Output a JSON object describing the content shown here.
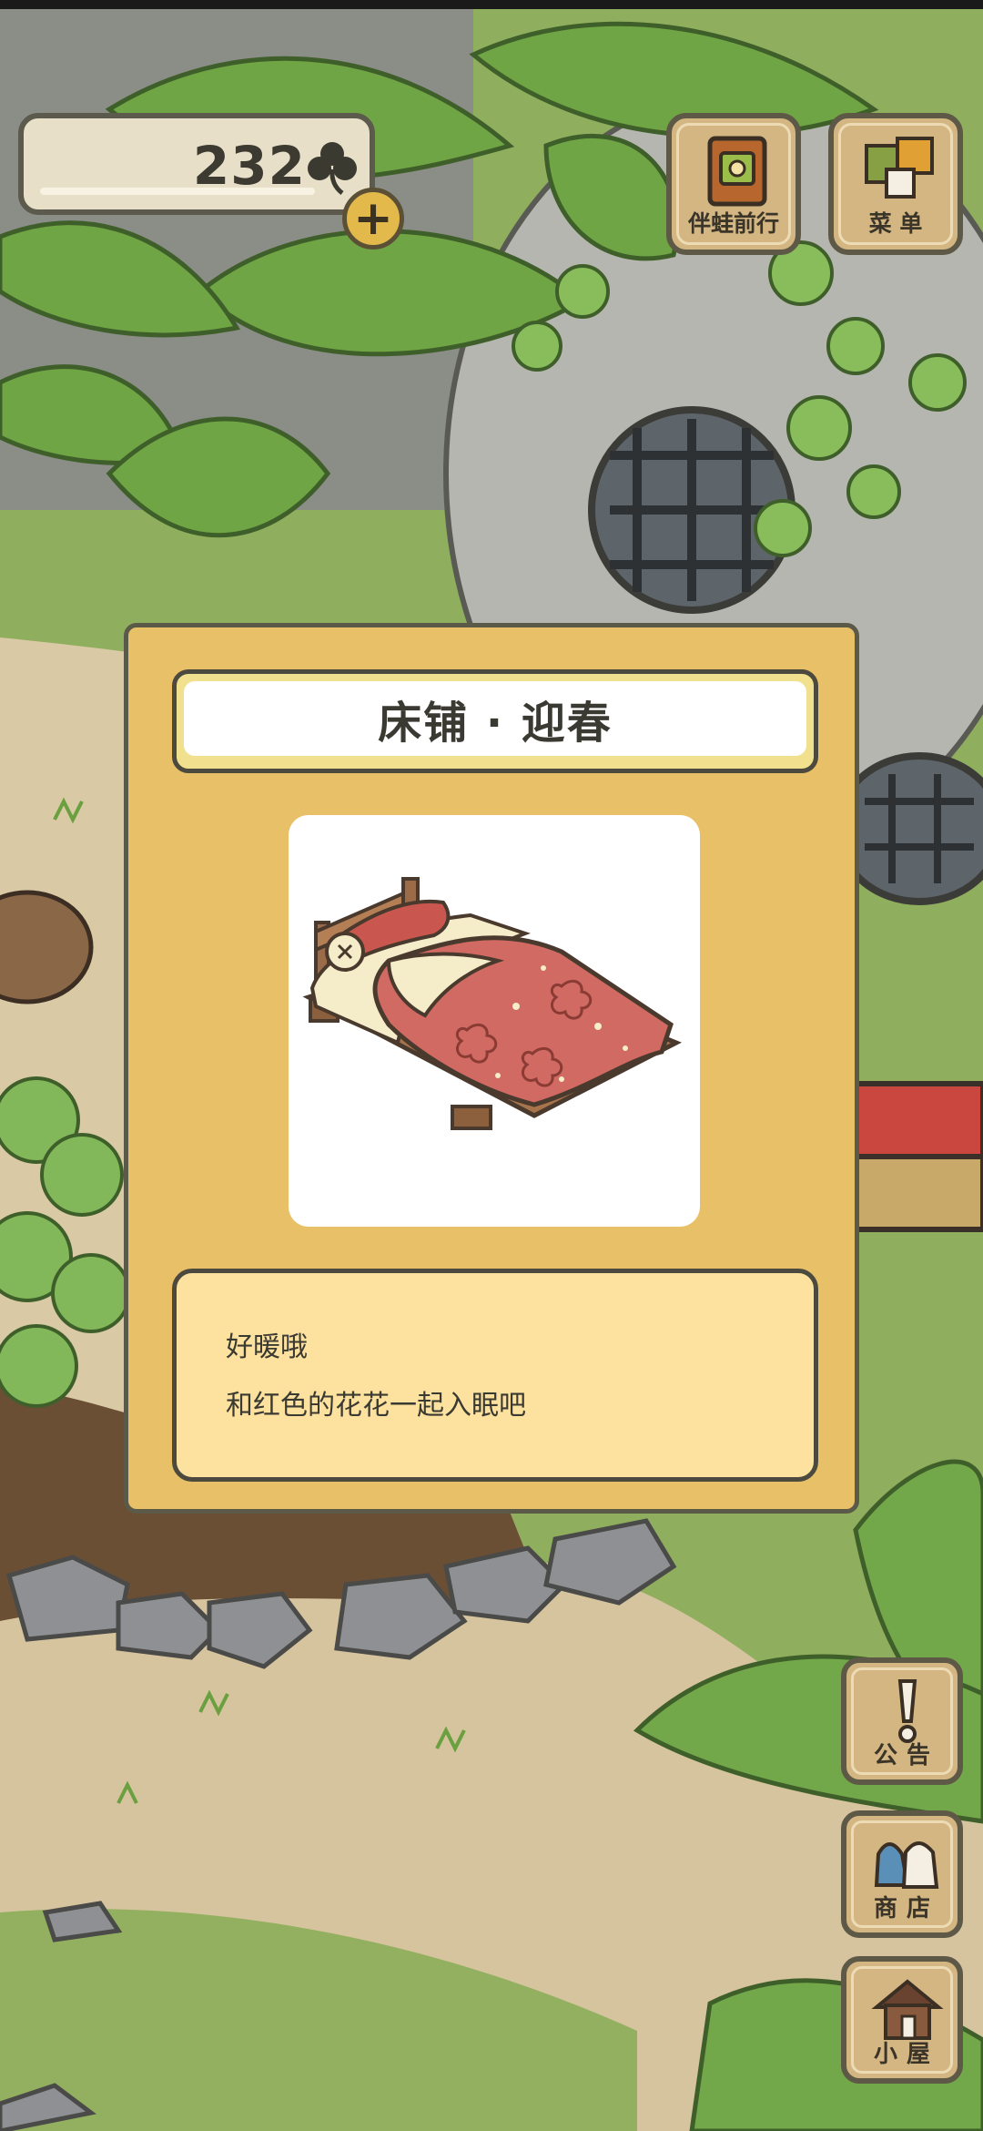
{
  "hud": {
    "clover_count": "232",
    "buttons": {
      "travel_label": "伴蛙前行",
      "menu_label": "菜 单"
    }
  },
  "side_buttons": {
    "notice_label": "公告",
    "shop_label": "商店",
    "house_label": "小屋"
  },
  "item_dialog": {
    "title": "床铺 · 迎春",
    "description_lines": [
      "好暖哦",
      "和红色的花花一起入眠吧"
    ]
  },
  "colors": {
    "dialog_bg": "#e8c068",
    "title_bg": "#ffffff",
    "desc_bg": "#fde19e",
    "button_bg": "#d4b682",
    "bed_red": "#d06a62",
    "bed_cream": "#f5edc9"
  },
  "icons": [
    "clover-icon",
    "plus-icon",
    "passport-icon",
    "menu-cards-icon",
    "exclamation-icon",
    "shop-bags-icon",
    "house-icon"
  ]
}
